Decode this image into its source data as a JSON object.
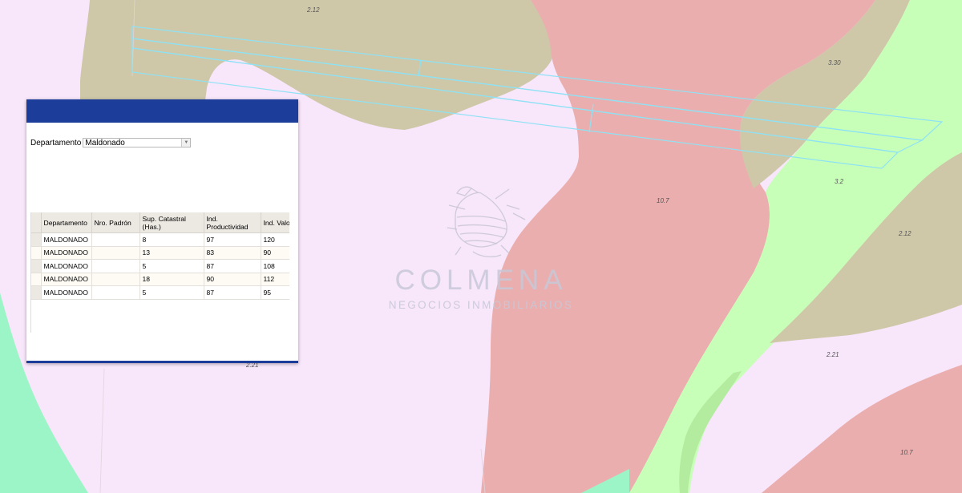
{
  "map": {
    "colors": {
      "background": "#f8e6fb",
      "olive": "#cec7a8",
      "red": "#ebaeae",
      "green": "#c8ffb8",
      "teal": "#9cf5c7",
      "parcel_outline": "#8ee2f4"
    },
    "soil_labels": [
      "2.12",
      "3.30",
      "3.2",
      "10.7",
      "2.12",
      "2.21",
      "2.21",
      "10.7"
    ]
  },
  "panel": {
    "department_label": "Departamento",
    "department_value": "Maldonado",
    "table": {
      "headers": [
        "Departamento",
        "Nro. Padrón",
        "Sup. Catastral (Has.)",
        "Ind. Productividad",
        "Ind. Valor"
      ],
      "rows": [
        [
          "MALDONADO",
          "",
          "8",
          "97",
          "120"
        ],
        [
          "MALDONADO",
          "",
          "13",
          "83",
          "90"
        ],
        [
          "MALDONADO",
          "",
          "5",
          "87",
          "108"
        ],
        [
          "MALDONADO",
          "",
          "18",
          "90",
          "112"
        ],
        [
          "MALDONADO",
          "",
          "5",
          "87",
          "95"
        ]
      ]
    }
  },
  "watermark": {
    "name": "COLMENA",
    "tagline": "NEGOCIOS INMOBILIARIOS",
    "icon": "beehive-logo-icon"
  }
}
